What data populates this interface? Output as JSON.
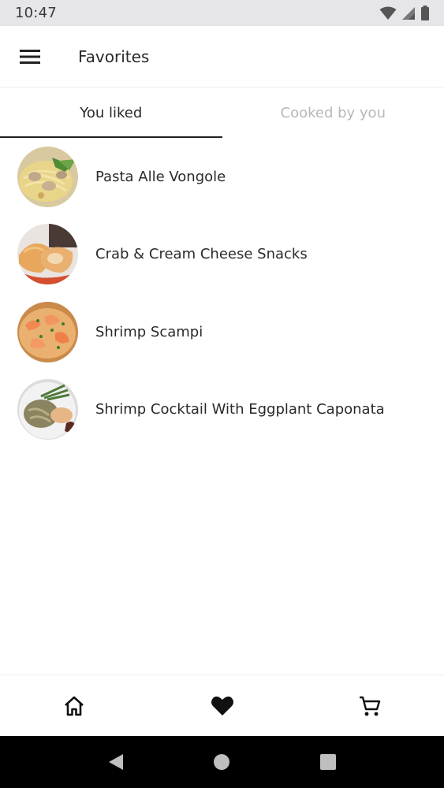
{
  "status_bar": {
    "time": "10:47"
  },
  "app_bar": {
    "title": "Favorites"
  },
  "tabs": [
    {
      "label": "You liked",
      "active": true
    },
    {
      "label": "Cooked by you",
      "active": false
    }
  ],
  "recipes": [
    {
      "name": "Pasta Alle Vongole"
    },
    {
      "name": "Crab & Cream Cheese Snacks"
    },
    {
      "name": "Shrimp Scampi"
    },
    {
      "name": "Shrimp Cocktail With Eggplant Caponata"
    }
  ],
  "bottom_nav": [
    {
      "icon": "home-icon"
    },
    {
      "icon": "heart-icon"
    },
    {
      "icon": "cart-icon"
    }
  ],
  "colors": {
    "active_tab_underline": "#222222",
    "inactive_tab_text": "#b8b8b8",
    "status_bar_bg": "#e6e6e9"
  }
}
